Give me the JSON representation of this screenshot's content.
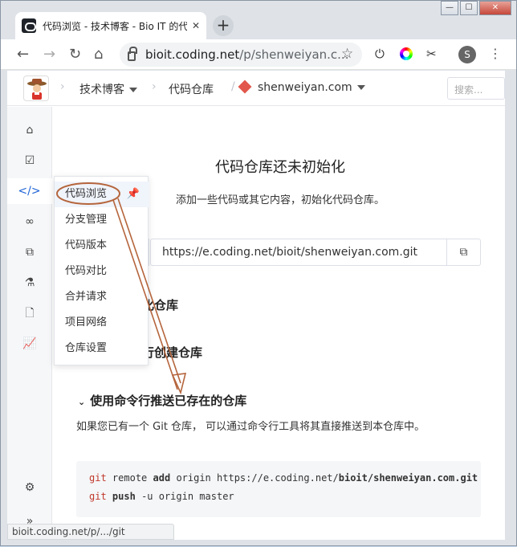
{
  "browser": {
    "tab_title": "代码浏览 - 技术博客 - Bio IT 的代码",
    "tab_close": "✕",
    "new_tab": "+",
    "url_host": "bioit.coding.net",
    "url_path": "/p/shenweiyan.c...",
    "profile_initial": "S",
    "status_url": "bioit.coding.net/p/.../git"
  },
  "window_controls": {
    "minimize": "—",
    "maximize": "☐",
    "close": "✕"
  },
  "topbar": {
    "project": "技术博客",
    "section": "代码仓库",
    "repo": "shenweiyan.com",
    "search_placeholder": "搜索..."
  },
  "menu": {
    "items": [
      {
        "label": "代码浏览"
      },
      {
        "label": "分支管理"
      },
      {
        "label": "代码版本"
      },
      {
        "label": "代码对比"
      },
      {
        "label": "合并请求"
      },
      {
        "label": "项目网络"
      },
      {
        "label": "仓库设置"
      }
    ]
  },
  "main": {
    "title": "代码仓库还未初始化",
    "subtitle": "添加一些代码或其它内容，初始化代码仓库。",
    "clone_url": "https://e.coding.net/bioit/shenweiyan.com.git",
    "sec1_tail": "化仓库",
    "sec2_tail": "行创建仓库",
    "sec3_title": "使用命令行推送已存在的仓库",
    "sec3_desc": "如果您已有一个 Git 仓库， 可以通过命令行工具将其直接推送到本仓库中。",
    "code": {
      "l1_git": "git",
      "l1_remote": "remote",
      "l1_add": "add",
      "l1_origin": "origin",
      "l1_url_prefix": "https://e.coding.net/",
      "l1_url_bold": "bioit/shenweiyan.com.git",
      "l2_git": "git",
      "l2_push": "push",
      "l2_rest": "-u origin master"
    }
  },
  "colors": {
    "accent": "#1f64d6",
    "annotation": "#b5653c",
    "repo_icon": "#e2574c"
  }
}
